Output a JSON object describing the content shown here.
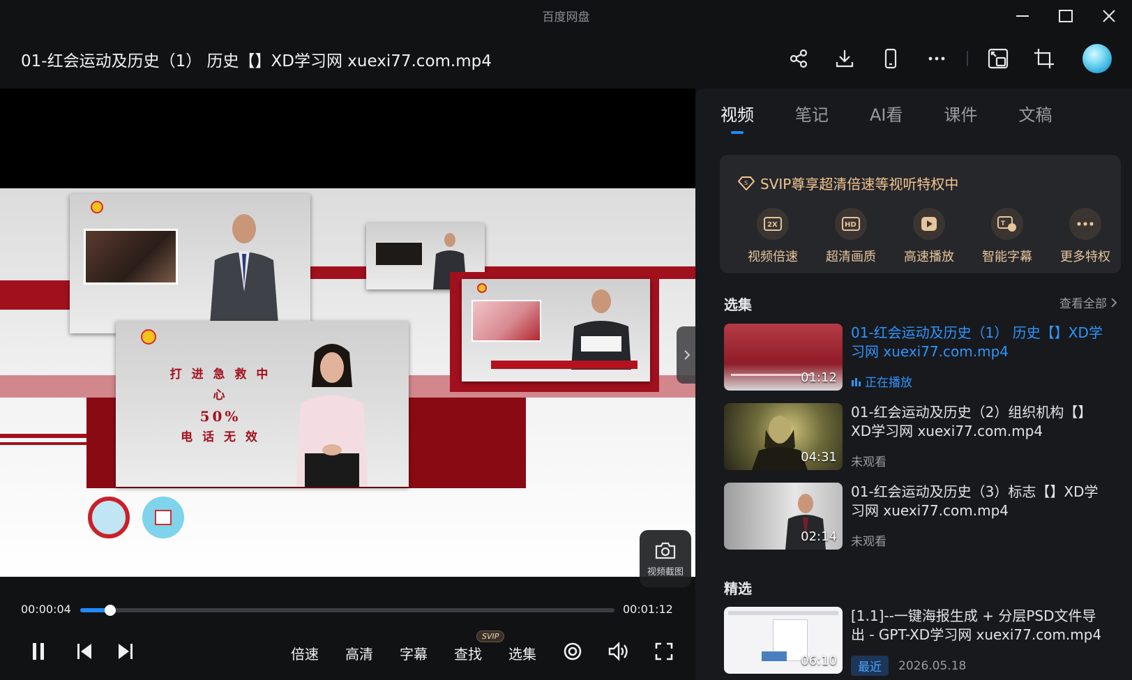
{
  "app": {
    "title": "百度网盘"
  },
  "file": {
    "title": "01-红会运动及历史（1） 历史【】XD学习网 xuexi77.com.mp4"
  },
  "video": {
    "panel_text": [
      "打 进 急 救 中 心",
      "50%",
      "电 话 无 效"
    ],
    "screenshot_label": "视频截图"
  },
  "player": {
    "current_time": "00:00:04",
    "total_time": "00:01:12",
    "progress_fraction": 0.056,
    "labels": {
      "speed": "倍速",
      "quality": "高清",
      "subtitle": "字幕",
      "search": "查找",
      "episodes": "选集"
    },
    "svip_tag": "SVIP"
  },
  "tabs": [
    "视频",
    "笔记",
    "AI看",
    "课件",
    "文稿"
  ],
  "svip": {
    "headline": "SVIP尊享超清倍速等视听特权中",
    "perks": [
      {
        "label": "视频倍速",
        "icon": "2x"
      },
      {
        "label": "超清画质",
        "icon": "HD"
      },
      {
        "label": "高速播放",
        "icon": "play"
      },
      {
        "label": "智能字幕",
        "icon": "subtitle"
      },
      {
        "label": "更多特权",
        "icon": "more"
      }
    ]
  },
  "episodes_section": {
    "title": "选集",
    "see_all": "查看全部"
  },
  "episodes": [
    {
      "title": "01-红会运动及历史（1） 历史【】XD学习网 xuexi77.com.mp4",
      "duration": "01:12",
      "status": "正在播放",
      "playing": true
    },
    {
      "title": "01-红会运动及历史（2）组织机构【】XD学习网 xuexi77.com.mp4",
      "duration": "04:31",
      "status": "未观看",
      "playing": false
    },
    {
      "title": "01-红会运动及历史（3）标志【】XD学习网 xuexi77.com.mp4",
      "duration": "02:14",
      "status": "未观看",
      "playing": false
    }
  ],
  "featured_section": {
    "title": "精选"
  },
  "featured": [
    {
      "title": "[1.1]--一键海报生成 + 分层PSD文件导出 - GPT-XD学习网 xuexi77.com.mp4",
      "duration": "06:10",
      "badge": "最近",
      "date": "2026.05.18"
    }
  ],
  "colors": {
    "accent": "#1f8bff",
    "svip_gold": "#f2c58f",
    "video_red": "#a1101d"
  }
}
